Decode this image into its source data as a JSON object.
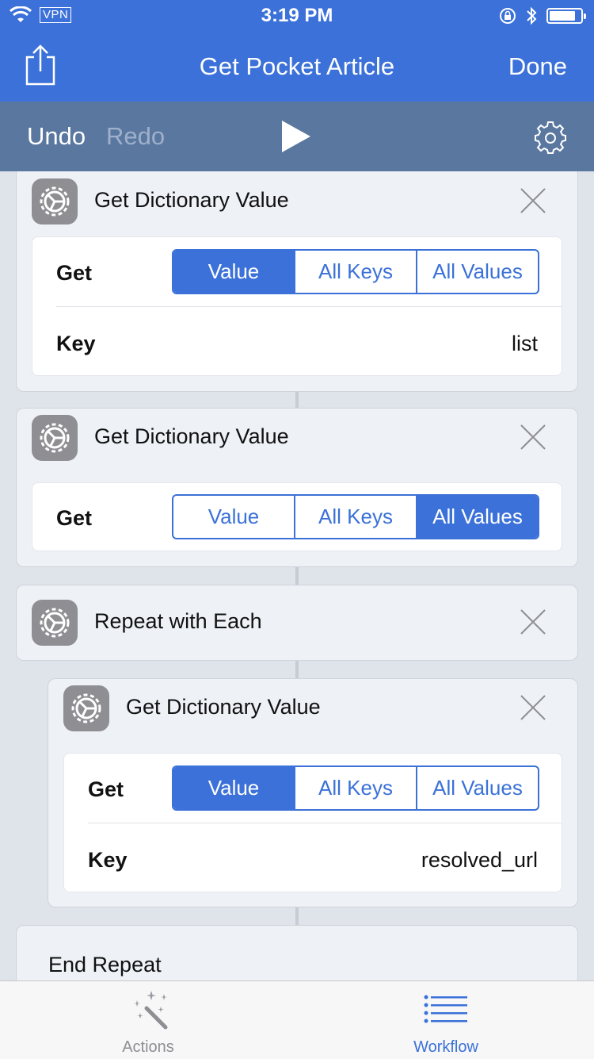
{
  "status_bar": {
    "vpn": "VPN",
    "time": "3:19 PM",
    "battery_level": 0.85
  },
  "nav": {
    "title": "Get Pocket Article",
    "done": "Done"
  },
  "toolbar": {
    "undo": "Undo",
    "redo": "Redo"
  },
  "actions": [
    {
      "title": "Get Dictionary Value",
      "get_label": "Get",
      "segments": [
        "Value",
        "All Keys",
        "All Values"
      ],
      "selected": "Value",
      "key_label": "Key",
      "key_value": "list"
    },
    {
      "title": "Get Dictionary Value",
      "get_label": "Get",
      "segments": [
        "Value",
        "All Keys",
        "All Values"
      ],
      "selected": "All Values"
    },
    {
      "title": "Repeat with Each"
    },
    {
      "title": "Get Dictionary Value",
      "get_label": "Get",
      "segments": [
        "Value",
        "All Keys",
        "All Values"
      ],
      "selected": "Value",
      "key_label": "Key",
      "key_value": "resolved_url"
    },
    {
      "title": "End Repeat"
    }
  ],
  "tabs": [
    {
      "label": "Actions",
      "active": false
    },
    {
      "label": "Workflow",
      "active": true
    }
  ],
  "colors": {
    "accent": "#3b71d8",
    "toolbar": "#5a77a0",
    "background": "#dfe3ea"
  }
}
